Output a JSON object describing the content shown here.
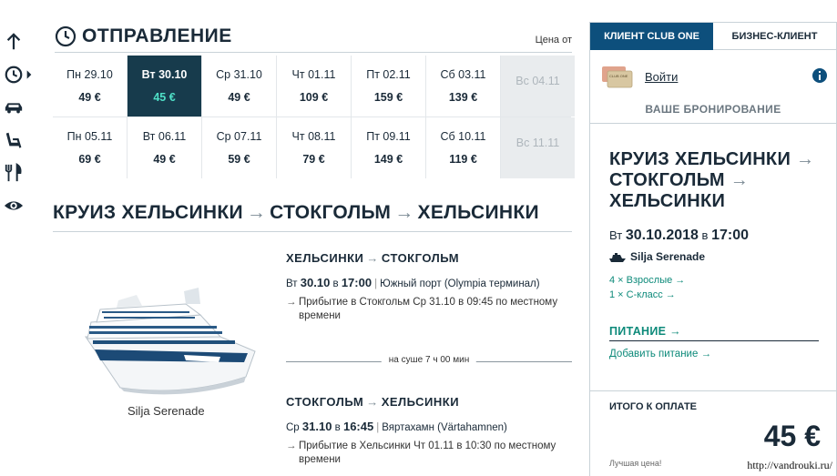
{
  "departure": {
    "title": "ОТПРАВЛЕНИЕ",
    "price_from": "Цена от",
    "days": [
      {
        "date": "Пн 29.10",
        "price": "49 €",
        "state": "normal"
      },
      {
        "date": "Вт 30.10",
        "price": "45 €",
        "state": "selected"
      },
      {
        "date": "Ср 31.10",
        "price": "49 €",
        "state": "normal"
      },
      {
        "date": "Чт 01.11",
        "price": "109 €",
        "state": "normal"
      },
      {
        "date": "Пт 02.11",
        "price": "159 €",
        "state": "normal"
      },
      {
        "date": "Сб 03.11",
        "price": "139 €",
        "state": "normal"
      },
      {
        "date": "Вс 04.11",
        "price": "",
        "state": "disabled"
      },
      {
        "date": "Пн 05.11",
        "price": "69 €",
        "state": "normal"
      },
      {
        "date": "Вт 06.11",
        "price": "49 €",
        "state": "normal"
      },
      {
        "date": "Ср 07.11",
        "price": "59 €",
        "state": "normal"
      },
      {
        "date": "Чт 08.11",
        "price": "79 €",
        "state": "normal"
      },
      {
        "date": "Пт 09.11",
        "price": "149 €",
        "state": "normal"
      },
      {
        "date": "Сб 10.11",
        "price": "119 €",
        "state": "normal"
      },
      {
        "date": "Вс 11.11",
        "price": "",
        "state": "disabled"
      }
    ]
  },
  "cruise": {
    "from": "КРУИЗ ХЕЛЬСИНКИ",
    "via": "СТОКГОЛЬМ",
    "to": "ХЕЛЬСИНКИ",
    "ship_name": "Silja Serenade",
    "leg1": {
      "from": "ХЕЛЬСИНКИ",
      "to": "СТОКГОЛЬМ",
      "day": "Вт",
      "date": "30.10",
      "in_word": "в",
      "time": "17:00",
      "port": "Южный порт (Olympia терминал)",
      "arrival": "Прибытие в Стокгольм Ср 31.10 в 09:45 по местному времени"
    },
    "onshore": "на суше 7 ч 00 мин",
    "leg2": {
      "from": "СТОКГОЛЬМ",
      "to": "ХЕЛЬСИНКИ",
      "day": "Ср",
      "date": "31.10",
      "in_word": "в",
      "time": "16:45",
      "port": "Вяртахамн (Värtahamnen)",
      "arrival": "Прибытие в Хельсинки Чт 01.11 в 10:30 по местному времени"
    }
  },
  "panel": {
    "tab_club": "КЛИЕНТ CLUB ONE",
    "tab_business": "БИЗНЕС-КЛИЕНТ",
    "login": "Войти",
    "my_booking": "ВАШЕ БРОНИРОВАНИЕ",
    "summary_line1": "КРУИЗ ХЕЛЬСИНКИ",
    "summary_line2": "СТОКГОЛЬМ",
    "summary_line3": "ХЕЛЬСИНКИ",
    "summary_day": "Вт",
    "summary_date": "30.10.2018",
    "summary_in": "в",
    "summary_time": "17:00",
    "summary_ship": "Silja Serenade",
    "adults": "4 × Взрослые →",
    "cabin": "1 × C-класс →",
    "food_title": "ПИТАНИЕ →",
    "food_add": "Добавить питание →",
    "total_label": "ИТОГО К ОПЛАТЕ",
    "total_price": "45 €",
    "best_price": "Лучшая цена!",
    "card_label": "CLUB ONE"
  },
  "watermark": "http://vandrouki.ru/",
  "colors": {
    "selected_bg": "#173b4c",
    "selected_price": "#4fe0c7",
    "tab_active": "#0d4f7c",
    "accent_teal": "#0d8a7a",
    "text": "#1a2a38"
  },
  "icons": [
    "arrow-up-icon",
    "clock-icon",
    "car-icon",
    "seat-icon",
    "cutlery-icon",
    "eye-icon",
    "info-icon",
    "ship-icon",
    "club-card-icon"
  ]
}
